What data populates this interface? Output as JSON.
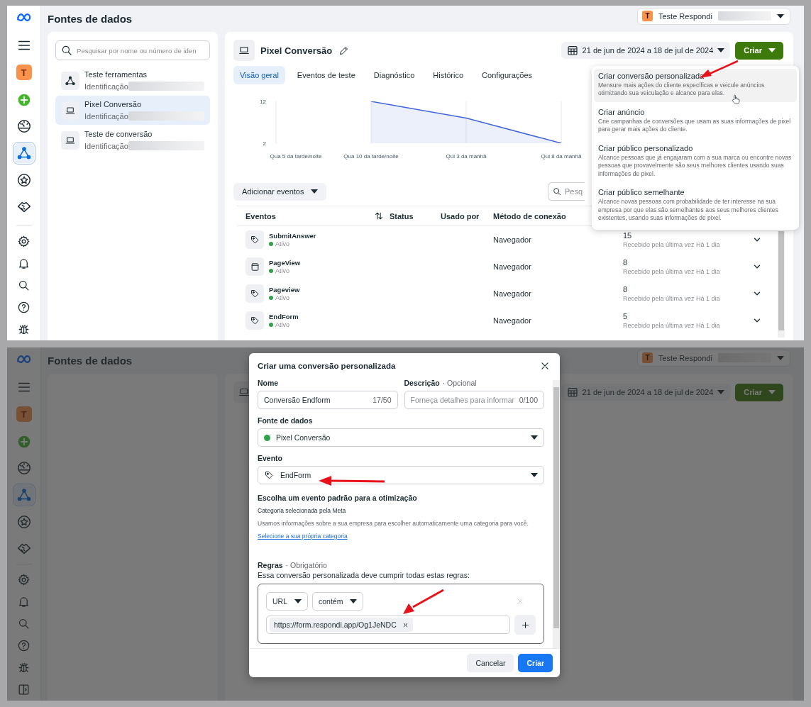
{
  "top_screen": {
    "rail": {
      "top_items": [
        {
          "kind": "menu",
          "selected": false
        },
        {
          "kind": "avatar",
          "initial": "T",
          "selected": false
        },
        {
          "kind": "add",
          "selected": false
        },
        {
          "kind": "gauge",
          "selected": false
        },
        {
          "kind": "network",
          "selected": true
        },
        {
          "kind": "star",
          "selected": false
        },
        {
          "kind": "handshake",
          "selected": false
        }
      ],
      "bottom_items": [
        {
          "kind": "gear",
          "selected": false
        },
        {
          "kind": "bell",
          "selected": false
        },
        {
          "kind": "search",
          "selected": false
        },
        {
          "kind": "help",
          "selected": false
        },
        {
          "kind": "bug",
          "selected": false
        }
      ]
    },
    "page_title": "Fontes de dados",
    "account": {
      "initial": "T",
      "name": "Teste Respondi"
    },
    "source_search": {
      "placeholder": "Pesquisar por nome ou número de iden"
    },
    "sources": [
      {
        "kind": "network",
        "name": "Teste ferramentas",
        "id_label": "Identificação",
        "selected": false
      },
      {
        "kind": "laptop",
        "name": "Pixel Conversão",
        "id_label": "Identificação",
        "selected": true
      },
      {
        "kind": "laptop",
        "name": "Teste de conversão",
        "id_label": "Identificação",
        "selected": false
      }
    ],
    "pixel_title": "Pixel Conversão",
    "date_range": "21 de jun de 2024 a 18 de jul de 2024",
    "create_button": "Criar",
    "tabs": [
      {
        "label": "Visão geral",
        "selected": true
      },
      {
        "label": "Eventos de teste",
        "selected": false
      },
      {
        "label": "Diagnóstico",
        "selected": false
      },
      {
        "label": "Histórico",
        "selected": false
      },
      {
        "label": "Configurações",
        "selected": false
      }
    ],
    "chart_data": {
      "type": "area",
      "categories": [
        "Qua 5 da tarde/noite",
        "Qua 10 da tarde/noite",
        "Qui 3 da manhã",
        "Qui 8 da manhã"
      ],
      "series": [
        {
          "color": "#4267d8",
          "values": [
            null,
            12,
            8,
            2
          ]
        }
      ],
      "ylim": [
        2,
        12
      ],
      "yticks": [
        2,
        12
      ],
      "grid": true
    },
    "add_events_button": "Adicionar eventos",
    "events_search": {
      "placeholder": "Pesq"
    },
    "events_table": {
      "columns": [
        "Eventos",
        "Status",
        "Usado por",
        "Método de conexão"
      ],
      "rows": [
        {
          "kind": "tag",
          "name": "SubmitAnswer",
          "status": "Ativo",
          "method": "Navegador",
          "column_5": "15",
          "column_5_detail": "Recebido pela última vez Há 1 dia"
        },
        {
          "kind": "page",
          "name": "PageView",
          "status": "Ativo",
          "method": "Navegador",
          "column_5": "8",
          "column_5_detail": "Recebido pela última vez Há 1 dia"
        },
        {
          "kind": "tag",
          "name": "Pageview",
          "status": "Ativo",
          "method": "Navegador",
          "column_5": "8",
          "column_5_detail": "Recebido pela última vez Há 1 dia"
        },
        {
          "kind": "tag",
          "name": "EndForm",
          "status": "Ativo",
          "method": "Navegador",
          "column_5": "5",
          "column_5_detail": "Recebido pela última vez Há 1 dia"
        }
      ]
    },
    "create_menu": {
      "items": [
        {
          "title": "Criar conversão personalizada",
          "description": "Mensure mais ações do cliente específicas e veicule anúncios otimizando sua veiculação e alcance para elas.",
          "selected": true
        },
        {
          "title": "Criar anúncio",
          "description": "Crie campanhas de conversões que usam as suas informações de pixel para gerar mais ações do cliente.",
          "selected": false
        },
        {
          "title": "Criar público personalizado",
          "description": "Alcance pessoas que já engajaram com a sua marca ou encontre novas pessoas que provavelmente são seus melhores clientes usando suas informações de pixel.",
          "selected": false
        },
        {
          "title": "Criar público semelhante",
          "description": "Alcance novas pessoas com probabilidade de ter interesse na sua empresa por que elas são semelhantes aos seus melhores clientes existentes, usando suas informações de pixel.",
          "selected": false
        }
      ]
    }
  },
  "bottom_screen": {
    "rail": {
      "top_items": [
        {
          "kind": "menu",
          "selected": false
        },
        {
          "kind": "avatar",
          "initial": "T",
          "selected": false
        },
        {
          "kind": "add",
          "selected": false
        },
        {
          "kind": "gauge",
          "selected": false
        },
        {
          "kind": "network",
          "selected": true
        },
        {
          "kind": "star",
          "selected": false
        },
        {
          "kind": "handshake",
          "selected": false
        }
      ],
      "bottom_items": [
        {
          "kind": "gear",
          "selected": false
        },
        {
          "kind": "bell",
          "selected": false
        },
        {
          "kind": "search",
          "selected": false
        },
        {
          "kind": "help",
          "selected": false
        },
        {
          "kind": "bug",
          "selected": false
        },
        {
          "kind": "panel",
          "selected": false
        }
      ]
    },
    "page_title": "Fontes de dados",
    "account": {
      "initial": "T",
      "name": "Teste Respondi"
    },
    "date_range": "21 de jun de 2024 a 18 de jul de 2024",
    "create_button": "Criar",
    "dialog": {
      "title": "Criar uma conversão personalizada",
      "name_field": {
        "label": "Nome",
        "value": "Conversão Endform",
        "counter": "17/50"
      },
      "description_field": {
        "label": "Descrição",
        "note": "· Opcional",
        "placeholder": "Forneça detalhes para informar",
        "counter": "0/100"
      },
      "source_field": {
        "label": "Fonte de dados",
        "value": "Pixel Conversão"
      },
      "event_field": {
        "label": "Evento",
        "value": "EndForm"
      },
      "optimization": {
        "heading": "Escolha um evento padrão para a otimização",
        "category": "Categoria selecionada pela Meta",
        "explanation": "Usamos informações sobre a sua empresa para escolher automaticamente uma categoria para você.",
        "link": "Selecione a sua própria categoria"
      },
      "rules": {
        "label": "Regras",
        "note": "· Obrigatório",
        "description": "Essa conversão personalizada deve cumprir todas estas regras:",
        "field": "URL",
        "operator": "contém",
        "values": [
          "https://form.respondi.app/Og1JeNDC"
        ]
      },
      "buttons": {
        "cancel": "Cancelar",
        "confirm": "Criar"
      }
    }
  }
}
